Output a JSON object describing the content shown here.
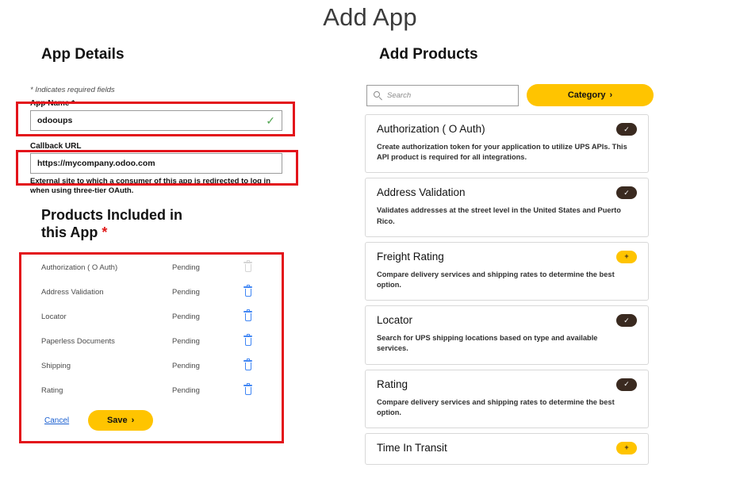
{
  "page": {
    "title": "Add App"
  },
  "left": {
    "section_title": "App Details",
    "required_note": "* Indicates required fields",
    "app_name": {
      "label": "App Name *",
      "value": "odooups",
      "valid_icon": "check-icon"
    },
    "callback_url": {
      "label": "Callback URL",
      "value": "https://mycompany.odoo.com",
      "helper": "External site to which a consumer of this app is redirected to log in when using three-tier OAuth."
    },
    "products_heading": "Products Included in this App",
    "products_heading_star": "*",
    "included_products": [
      {
        "name": "Authorization ( O Auth)",
        "status": "Pending",
        "delete_enabled": false
      },
      {
        "name": "Address Validation",
        "status": "Pending",
        "delete_enabled": true
      },
      {
        "name": "Locator",
        "status": "Pending",
        "delete_enabled": true
      },
      {
        "name": "Paperless Documents",
        "status": "Pending",
        "delete_enabled": true
      },
      {
        "name": "Shipping",
        "status": "Pending",
        "delete_enabled": true
      },
      {
        "name": "Rating",
        "status": "Pending",
        "delete_enabled": true
      }
    ],
    "cancel_label": "Cancel",
    "save_label": "Save",
    "save_chevron": "›"
  },
  "right": {
    "section_title": "Add Products",
    "search": {
      "placeholder": "Search",
      "value": "",
      "icon": "search-icon"
    },
    "category_button": {
      "label": "Category",
      "chevron": "›"
    },
    "products": [
      {
        "title": "Authorization ( O Auth)",
        "description": "Create authorization token for your application to utilize UPS APIs. This API product is required for all integrations.",
        "state": "selected",
        "badge_glyph": "✓"
      },
      {
        "title": "Address Validation",
        "description": "Validates addresses at the street level in the United States and Puerto Rico.",
        "state": "selected",
        "badge_glyph": "✓"
      },
      {
        "title": "Freight Rating",
        "description": "Compare delivery services and shipping rates to determine the best option.",
        "state": "add",
        "badge_glyph": "+"
      },
      {
        "title": "Locator",
        "description": "Search for UPS shipping locations based on type and available services.",
        "state": "selected",
        "badge_glyph": "✓"
      },
      {
        "title": "Rating",
        "description": "Compare delivery services and shipping rates to determine the best option.",
        "state": "selected",
        "badge_glyph": "✓"
      },
      {
        "title": "Time In Transit",
        "description": "",
        "state": "add",
        "badge_glyph": "+"
      }
    ]
  },
  "annotations": {
    "color": "#e3141b",
    "boxes": [
      {
        "name": "app-name-highlight"
      },
      {
        "name": "callback-url-highlight"
      },
      {
        "name": "products-included-highlight"
      }
    ]
  },
  "colors": {
    "brand_yellow": "#ffc400",
    "brand_brown": "#3a2a20",
    "link_blue": "#1a5fd0",
    "trash_blue": "#4086f4",
    "valid_green": "#53a653",
    "annotation_red": "#e3141b"
  }
}
